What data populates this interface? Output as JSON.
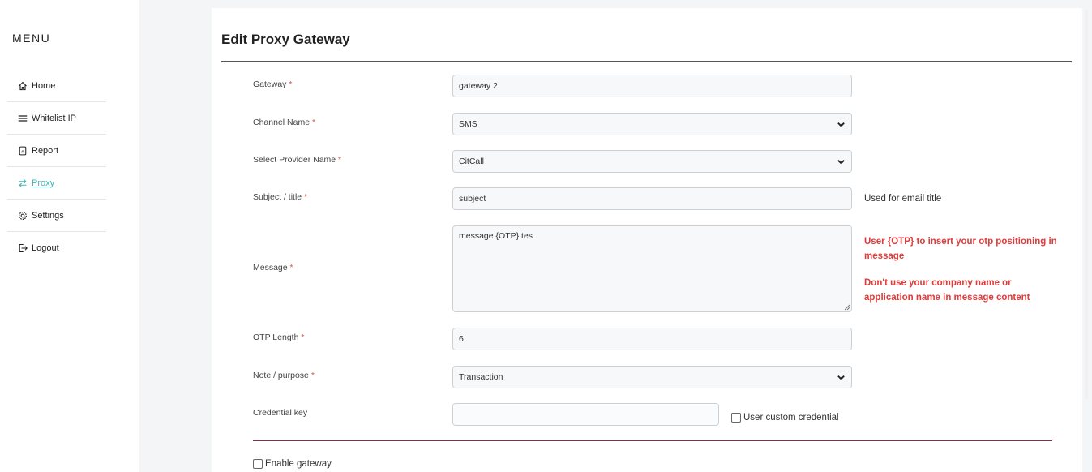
{
  "sidebar": {
    "title": "MENU",
    "items": [
      {
        "label": "Home",
        "icon": "home-icon"
      },
      {
        "label": "Whitelist IP",
        "icon": "list-icon"
      },
      {
        "label": "Report",
        "icon": "report-icon"
      },
      {
        "label": "Proxy",
        "icon": "swap-icon",
        "active": true
      },
      {
        "label": "Settings",
        "icon": "gear-icon"
      },
      {
        "label": "Logout",
        "icon": "logout-icon"
      }
    ]
  },
  "form": {
    "title": "Edit Proxy Gateway",
    "required_mark": "*",
    "gateway": {
      "label": "Gateway",
      "value": "gateway 2"
    },
    "channel": {
      "label": "Channel Name",
      "value": "SMS"
    },
    "provider": {
      "label": "Select Provider Name",
      "value": "CitCall"
    },
    "subject": {
      "label": "Subject / title",
      "value": "subject",
      "hint": "Used for email title"
    },
    "message": {
      "label": "Message",
      "value": "message {OTP} tes",
      "warning_1": "User {OTP} to insert your otp positioning in message",
      "warning_2": "Don't use your company name or application name in message content"
    },
    "otp_length": {
      "label": "OTP Length",
      "value": "6"
    },
    "note": {
      "label": "Note / purpose",
      "value": "Transaction"
    },
    "credential": {
      "label": "Credential key",
      "value": "",
      "checkbox_label": "User custom credential",
      "checked": false
    },
    "enable": {
      "label": "Enable gateway",
      "checked": false
    }
  },
  "colors": {
    "accent": "#3fb6b6",
    "required": "#d9534f",
    "warning": "#e03a3a",
    "separator": "#8b2a4a"
  }
}
